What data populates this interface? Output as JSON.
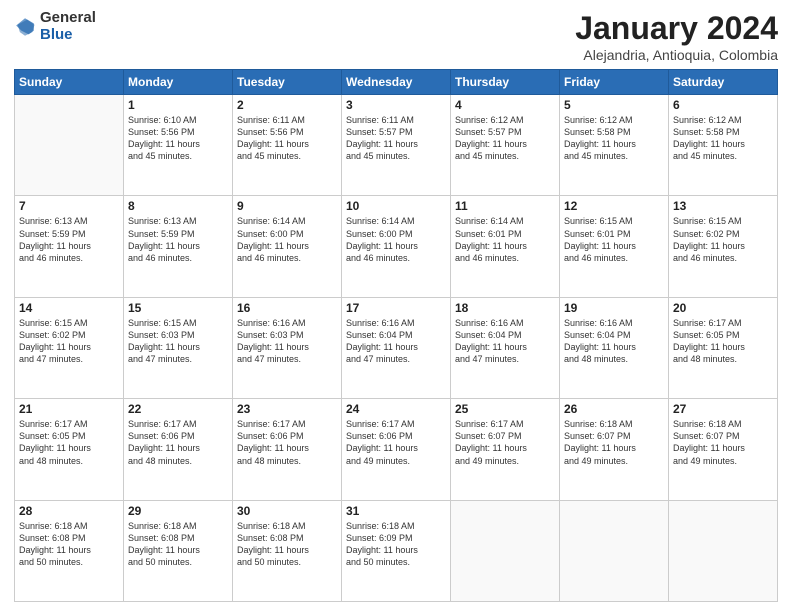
{
  "header": {
    "logo_general": "General",
    "logo_blue": "Blue",
    "main_title": "January 2024",
    "subtitle": "Alejandria, Antioquia, Colombia"
  },
  "weekdays": [
    "Sunday",
    "Monday",
    "Tuesday",
    "Wednesday",
    "Thursday",
    "Friday",
    "Saturday"
  ],
  "weeks": [
    [
      {
        "day": "",
        "info": ""
      },
      {
        "day": "1",
        "info": "Sunrise: 6:10 AM\nSunset: 5:56 PM\nDaylight: 11 hours\nand 45 minutes."
      },
      {
        "day": "2",
        "info": "Sunrise: 6:11 AM\nSunset: 5:56 PM\nDaylight: 11 hours\nand 45 minutes."
      },
      {
        "day": "3",
        "info": "Sunrise: 6:11 AM\nSunset: 5:57 PM\nDaylight: 11 hours\nand 45 minutes."
      },
      {
        "day": "4",
        "info": "Sunrise: 6:12 AM\nSunset: 5:57 PM\nDaylight: 11 hours\nand 45 minutes."
      },
      {
        "day": "5",
        "info": "Sunrise: 6:12 AM\nSunset: 5:58 PM\nDaylight: 11 hours\nand 45 minutes."
      },
      {
        "day": "6",
        "info": "Sunrise: 6:12 AM\nSunset: 5:58 PM\nDaylight: 11 hours\nand 45 minutes."
      }
    ],
    [
      {
        "day": "7",
        "info": "Sunrise: 6:13 AM\nSunset: 5:59 PM\nDaylight: 11 hours\nand 46 minutes."
      },
      {
        "day": "8",
        "info": "Sunrise: 6:13 AM\nSunset: 5:59 PM\nDaylight: 11 hours\nand 46 minutes."
      },
      {
        "day": "9",
        "info": "Sunrise: 6:14 AM\nSunset: 6:00 PM\nDaylight: 11 hours\nand 46 minutes."
      },
      {
        "day": "10",
        "info": "Sunrise: 6:14 AM\nSunset: 6:00 PM\nDaylight: 11 hours\nand 46 minutes."
      },
      {
        "day": "11",
        "info": "Sunrise: 6:14 AM\nSunset: 6:01 PM\nDaylight: 11 hours\nand 46 minutes."
      },
      {
        "day": "12",
        "info": "Sunrise: 6:15 AM\nSunset: 6:01 PM\nDaylight: 11 hours\nand 46 minutes."
      },
      {
        "day": "13",
        "info": "Sunrise: 6:15 AM\nSunset: 6:02 PM\nDaylight: 11 hours\nand 46 minutes."
      }
    ],
    [
      {
        "day": "14",
        "info": "Sunrise: 6:15 AM\nSunset: 6:02 PM\nDaylight: 11 hours\nand 47 minutes."
      },
      {
        "day": "15",
        "info": "Sunrise: 6:15 AM\nSunset: 6:03 PM\nDaylight: 11 hours\nand 47 minutes."
      },
      {
        "day": "16",
        "info": "Sunrise: 6:16 AM\nSunset: 6:03 PM\nDaylight: 11 hours\nand 47 minutes."
      },
      {
        "day": "17",
        "info": "Sunrise: 6:16 AM\nSunset: 6:04 PM\nDaylight: 11 hours\nand 47 minutes."
      },
      {
        "day": "18",
        "info": "Sunrise: 6:16 AM\nSunset: 6:04 PM\nDaylight: 11 hours\nand 47 minutes."
      },
      {
        "day": "19",
        "info": "Sunrise: 6:16 AM\nSunset: 6:04 PM\nDaylight: 11 hours\nand 48 minutes."
      },
      {
        "day": "20",
        "info": "Sunrise: 6:17 AM\nSunset: 6:05 PM\nDaylight: 11 hours\nand 48 minutes."
      }
    ],
    [
      {
        "day": "21",
        "info": "Sunrise: 6:17 AM\nSunset: 6:05 PM\nDaylight: 11 hours\nand 48 minutes."
      },
      {
        "day": "22",
        "info": "Sunrise: 6:17 AM\nSunset: 6:06 PM\nDaylight: 11 hours\nand 48 minutes."
      },
      {
        "day": "23",
        "info": "Sunrise: 6:17 AM\nSunset: 6:06 PM\nDaylight: 11 hours\nand 48 minutes."
      },
      {
        "day": "24",
        "info": "Sunrise: 6:17 AM\nSunset: 6:06 PM\nDaylight: 11 hours\nand 49 minutes."
      },
      {
        "day": "25",
        "info": "Sunrise: 6:17 AM\nSunset: 6:07 PM\nDaylight: 11 hours\nand 49 minutes."
      },
      {
        "day": "26",
        "info": "Sunrise: 6:18 AM\nSunset: 6:07 PM\nDaylight: 11 hours\nand 49 minutes."
      },
      {
        "day": "27",
        "info": "Sunrise: 6:18 AM\nSunset: 6:07 PM\nDaylight: 11 hours\nand 49 minutes."
      }
    ],
    [
      {
        "day": "28",
        "info": "Sunrise: 6:18 AM\nSunset: 6:08 PM\nDaylight: 11 hours\nand 50 minutes."
      },
      {
        "day": "29",
        "info": "Sunrise: 6:18 AM\nSunset: 6:08 PM\nDaylight: 11 hours\nand 50 minutes."
      },
      {
        "day": "30",
        "info": "Sunrise: 6:18 AM\nSunset: 6:08 PM\nDaylight: 11 hours\nand 50 minutes."
      },
      {
        "day": "31",
        "info": "Sunrise: 6:18 AM\nSunset: 6:09 PM\nDaylight: 11 hours\nand 50 minutes."
      },
      {
        "day": "",
        "info": ""
      },
      {
        "day": "",
        "info": ""
      },
      {
        "day": "",
        "info": ""
      }
    ]
  ]
}
